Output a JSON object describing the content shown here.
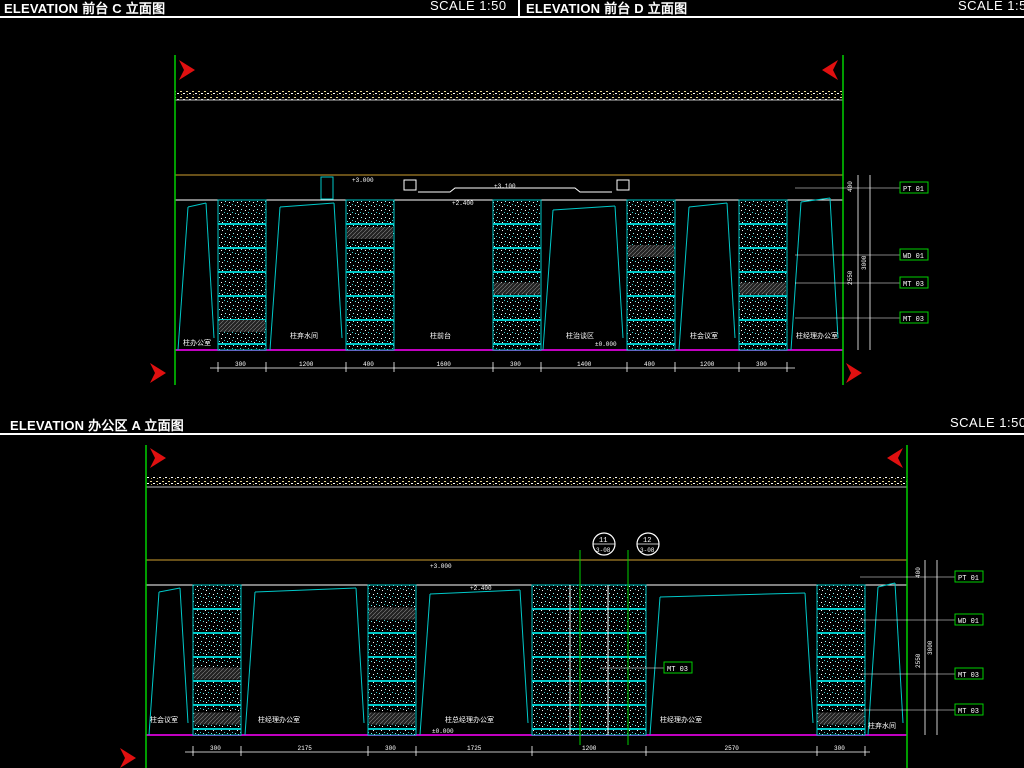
{
  "panels": {
    "c": {
      "title": "ELEVATION 前台 C 立面图",
      "scale": "SCALE 1:50"
    },
    "d": {
      "title": "ELEVATION 前台 D 立面图",
      "scale": "SCALE 1:5"
    },
    "a": {
      "title": "ELEVATION 办公区 A 立面图",
      "scale": "SCALE 1:50"
    }
  },
  "elev1": {
    "tags": [
      "PT 01",
      "WD 01",
      "MT 03",
      "MT 03"
    ],
    "room_labels": [
      "柱办公室",
      "柱弃水间",
      "柱前台",
      "柱治谈区",
      "柱会议室",
      "柱经理办公室"
    ],
    "dims": [
      "300",
      "1200",
      "400",
      "1600",
      "300",
      "1400",
      "400",
      "1200",
      "300"
    ],
    "levels": [
      "+3.000",
      "+2.400",
      "±0.000",
      "+3.100"
    ],
    "right_dims": [
      "400",
      "2550",
      "3000"
    ]
  },
  "elev2": {
    "tags": [
      "PT 01",
      "WD 01",
      "MT 03",
      "MT 03",
      "MT 03"
    ],
    "room_labels": [
      "柱会议室",
      "柱经理办公室",
      "柱总经理办公室",
      "柱经理办公室",
      "柱弃水间"
    ],
    "dims": [
      "300",
      "2175",
      "300",
      "1725",
      "1200",
      "2570",
      "300"
    ],
    "levels": [
      "+3.000",
      "+2.400",
      "±0.000"
    ],
    "callouts": [
      "11",
      "12"
    ],
    "callout_sub": [
      "3-08",
      "3-08"
    ],
    "right_dims": [
      "400",
      "2550",
      "3000"
    ]
  },
  "colors": {
    "column": "#00c8c8",
    "floor": "#c000c0",
    "ceiling": "#d0a030",
    "frame": "#00d000",
    "marker": "#e01010",
    "tag_border": "#00d000"
  }
}
